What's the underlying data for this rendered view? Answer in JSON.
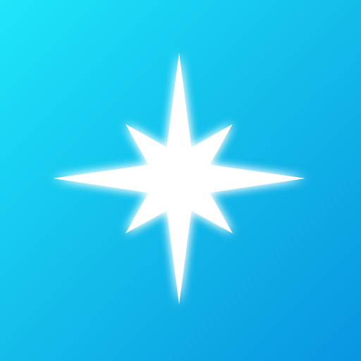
{
  "icon": {
    "name": "compass-star-icon",
    "colors": {
      "background_start": "#1ee6fb",
      "background_mid": "#12bdea",
      "background_end": "#0896e0",
      "star": "#ffffff",
      "glow": "#ffffff"
    }
  }
}
